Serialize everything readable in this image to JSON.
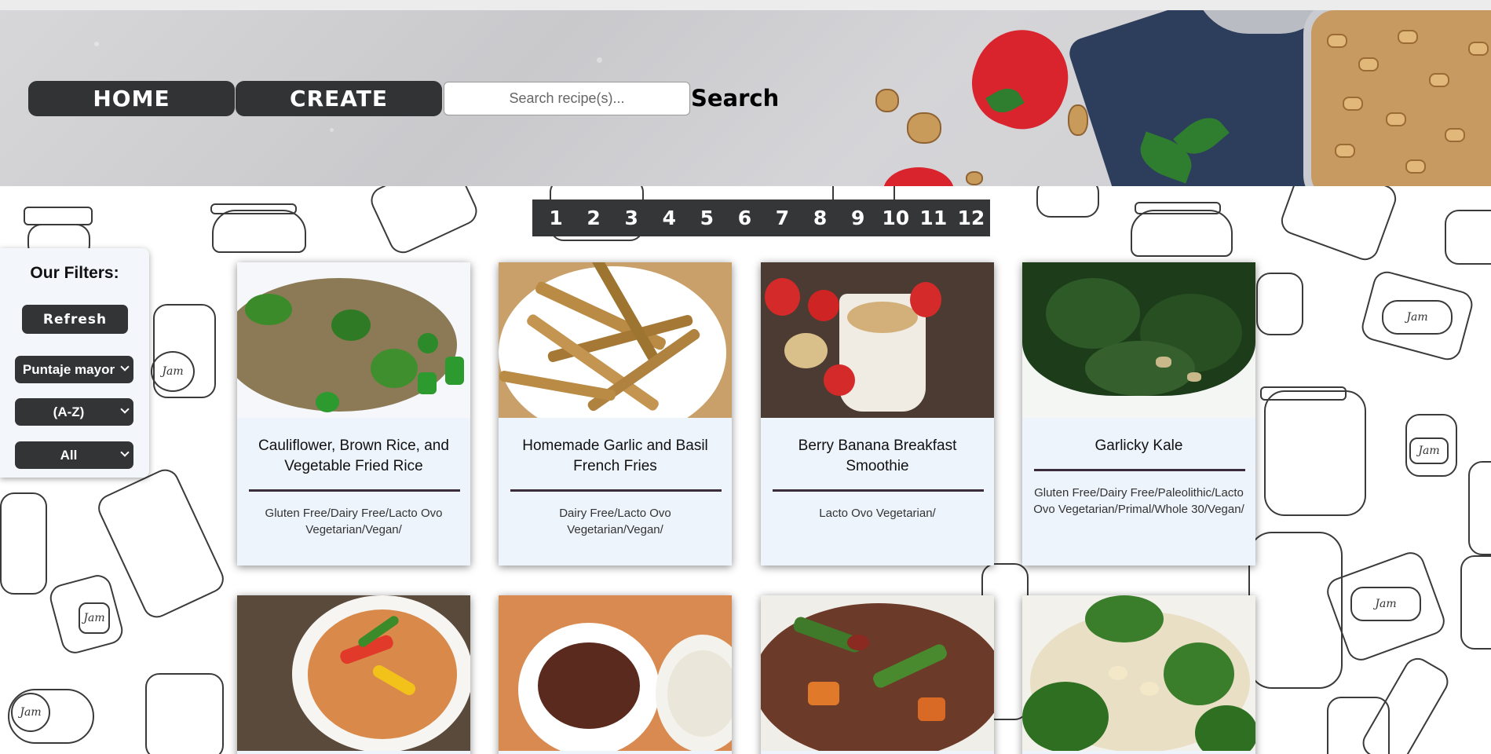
{
  "nav": {
    "home_label": "HOME",
    "create_label": "CREATE"
  },
  "search": {
    "placeholder": "Search recipe(s)...",
    "button_label": "Search"
  },
  "pagination": [
    "1",
    "2",
    "3",
    "4",
    "5",
    "6",
    "7",
    "8",
    "9",
    "10",
    "11",
    "12"
  ],
  "filters": {
    "title": "Our Filters:",
    "refresh_label": "Refresh",
    "sort_score": "Puntaje mayor",
    "sort_alpha": "(A-Z)",
    "diet": "All"
  },
  "recipes": [
    {
      "title": "Cauliflower, Brown Rice, and Vegetable Fried Rice",
      "diets": "Gluten Free/Dairy Free/Lacto Ovo Vegetarian/Vegan/",
      "image": "fried-rice-photo"
    },
    {
      "title": "Homemade Garlic and Basil French Fries",
      "diets": "Dairy Free/Lacto Ovo Vegetarian/Vegan/",
      "image": "french-fries-photo"
    },
    {
      "title": "Berry Banana Breakfast Smoothie",
      "diets": "Lacto Ovo Vegetarian/",
      "image": "smoothie-photo"
    },
    {
      "title": "Garlicky Kale",
      "diets": "Gluten Free/Dairy Free/Paleolithic/Lacto Ovo Vegetarian/Primal/Whole 30/Vegan/",
      "image": "kale-photo"
    },
    {
      "title": "",
      "diets": "",
      "image": "curry-soup-photo"
    },
    {
      "title": "",
      "diets": "",
      "image": "stew-with-rice-photo"
    },
    {
      "title": "",
      "diets": "",
      "image": "bean-vegetable-stew-photo"
    },
    {
      "title": "",
      "diets": "",
      "image": "broccoli-rice-photo"
    }
  ],
  "colors": {
    "nav_bg": "#323335",
    "card_bg": "#eef4fc",
    "pager_bg": "#353638",
    "rule": "#3a2c3c"
  }
}
